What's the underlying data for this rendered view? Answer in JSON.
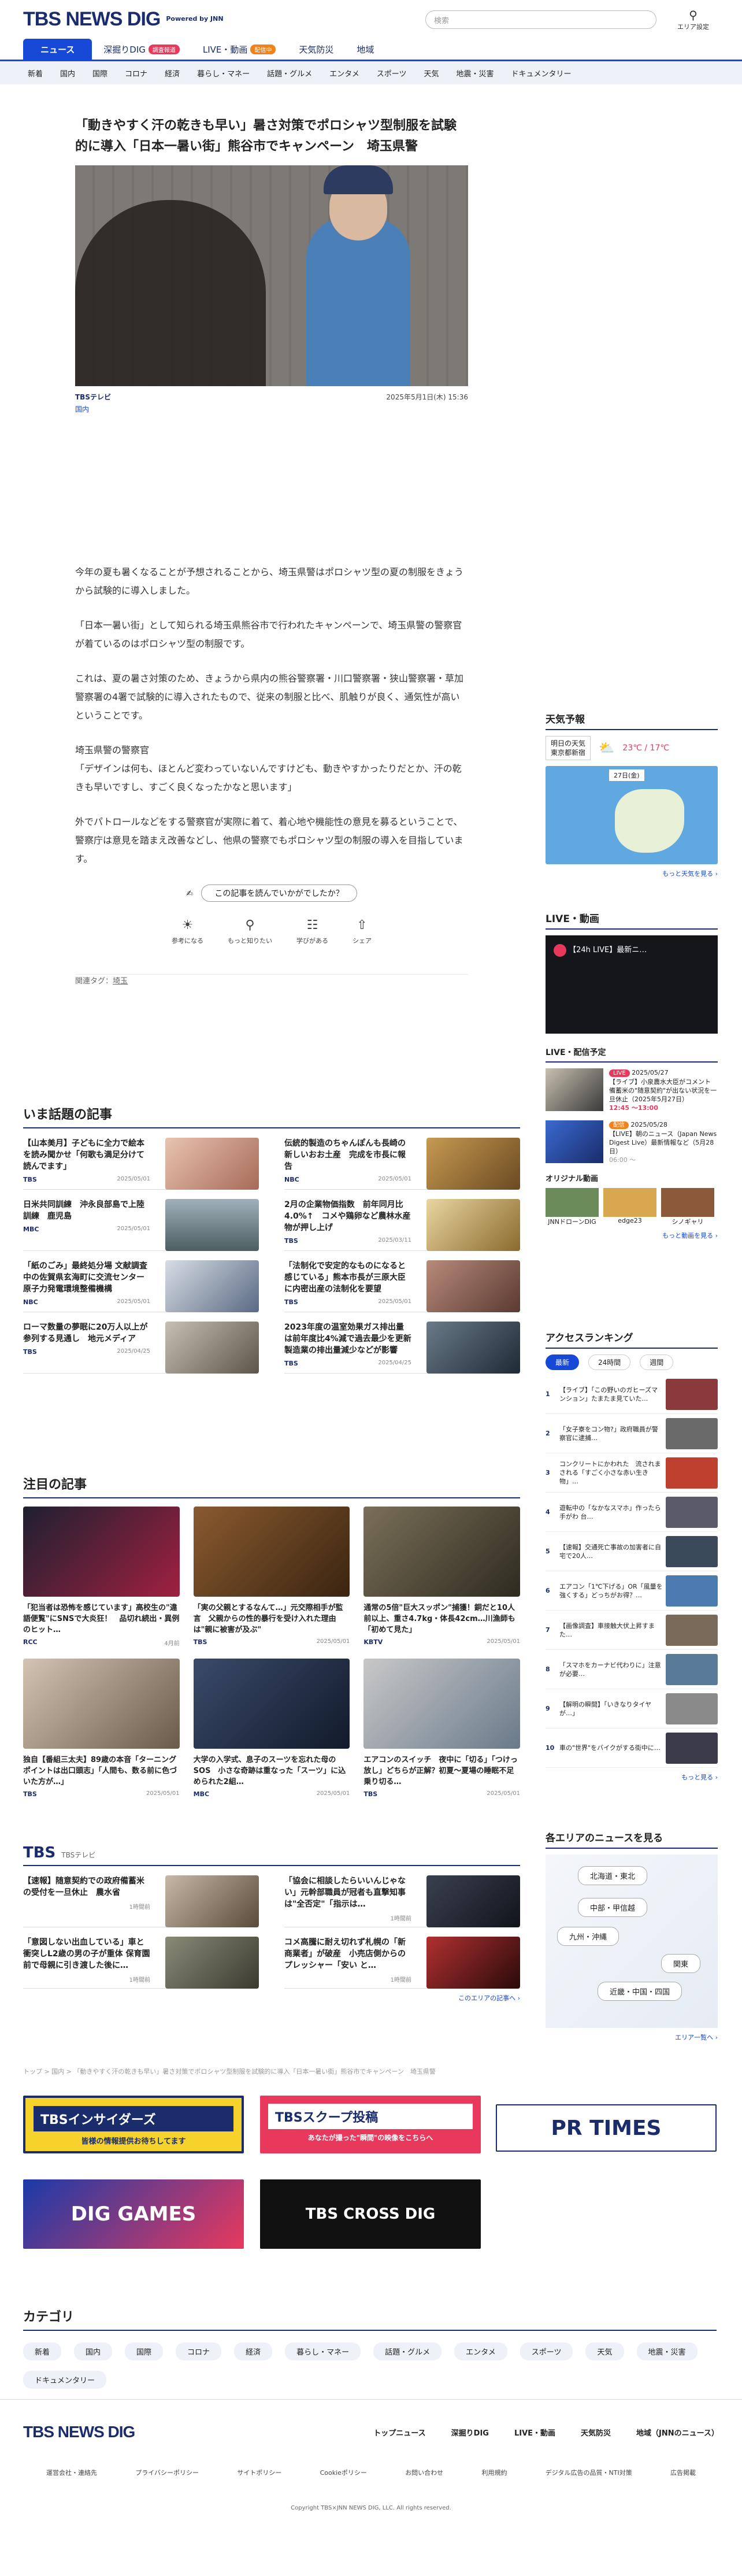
{
  "header": {
    "logo": "TBS NEWS DIG",
    "powered": "Powered by JNN",
    "search_placeholder": "検索",
    "area_label": "エリア設定"
  },
  "tabs": [
    {
      "label": "ニュース"
    },
    {
      "label": "深掘りDIG",
      "badge": "調査報道"
    },
    {
      "label": "LIVE・動画",
      "badge": "配信中"
    },
    {
      "label": "天気防災"
    },
    {
      "label": "地域"
    }
  ],
  "categories": [
    "新着",
    "国内",
    "国際",
    "コロナ",
    "経済",
    "暮らし・マネー",
    "話題・グルメ",
    "エンタメ",
    "スポーツ",
    "天気",
    "地震・災害",
    "ドキュメンタリー"
  ],
  "article": {
    "title": "「動きやすく汗の乾きも早い」暑さ対策でポロシャツ型制服を試験的に導入「日本一暑い街」熊谷市でキャンペーン　埼玉県警",
    "source": "TBSテレビ",
    "date": "2025年5月1日(木) 15:36",
    "category": "国内",
    "paragraphs": [
      "今年の夏も暑くなることが予想されることから、埼玉県警はポロシャツ型の夏の制服をきょうから試験的に導入しました。",
      "「日本一暑い街」として知られる埼玉県熊谷市で行われたキャンペーンで、埼玉県警の警察官が着ているのはポロシャツ型の制服です。",
      "これは、夏の暑さ対策のため、きょうから県内の熊谷警察署・川口警察署・狭山警察署・草加警察署の4署で試験的に導入されたもので、従来の制服と比べ、肌触りが良く、通気性が高いということです。",
      "埼玉県警の警察官\n「デザインは何も、ほとんど変わっていないんですけども、動きやすかったりだとか、汗の乾きも早いですし、すごく良くなったかなと思います」",
      "外でパトロールなどをする警察官が実際に着て、着心地や機能性の意見を募るということで、警察庁は意見を踏まえ改善などし、他県の警察でもポロシャツ型の制服の導入を目指しています。"
    ],
    "rate_question": "この記事を読んでいかがでしたか？",
    "reactions": [
      "参考になる",
      "もっと知りたい",
      "学びがある",
      "シェア"
    ],
    "tags_label": "関連タグ：",
    "tag": "埼玉"
  },
  "trending": {
    "heading": "いま話題の記事",
    "items": [
      {
        "title": "【山本美月】子どもに全力で絵本を読み聞かせ「何歌も満足分けて読んでます」",
        "src": "TBS",
        "date": "2025/05/01"
      },
      {
        "title": "伝統的製造のちゃんぽんも長崎の新しいおお土産　完成を市長に報告",
        "src": "NBC",
        "date": "2025/05/01"
      },
      {
        "title": "日米共同訓練　沖永良部島で上陸訓練　鹿児島",
        "src": "MBC",
        "date": "2025/05/01"
      },
      {
        "title": "2月の企業物価指数　前年同月比4.0%↑　コメや鶏卵など農林水産物が押し上げ",
        "src": "TBS",
        "date": "2025/03/11"
      },
      {
        "title": "「紙のごみ」最終処分場 文献調査中の佐賀県玄海町に交流センター　原子力発電環境整備機構",
        "src": "NBC",
        "date": "2025/05/01"
      },
      {
        "title": "「法制化で安定的なものになると感じている」熊本市長が三原大臣に内密出産の法制化を要望",
        "src": "TBS",
        "date": "2025/05/01"
      },
      {
        "title": "ローマ数量の夢眠に20万人以上が参列する見通し　地元メディア",
        "src": "TBS",
        "date": "2025/04/25"
      },
      {
        "title": "2023年度の温室効果ガス排出量は前年度比4%減で過去最少を更新　製造業の排出量減少などが影響",
        "src": "TBS",
        "date": "2025/04/25"
      }
    ]
  },
  "featured": {
    "heading": "注目の記事",
    "items": [
      {
        "title": "「犯当者は恐怖を感じています」高校生の\"違語便覧\"にSNSで大炎狂！　品切れ続出・異例のヒット…",
        "src": "RCC",
        "date": "4月前"
      },
      {
        "title": "「実の父親とするなんて…」元交際相手が監言　父親からの性的暴行を受け入れた理由は\"親に被害が及ぶ\"",
        "src": "TBS",
        "date": "2025/05/01"
      },
      {
        "title": "通常の5倍\"巨大スッポン\"捕獲！銅だと10人前以上、重さ4.7kg・体長42cm…川漁師も「初めて見た」",
        "src": "KBTV",
        "date": "2025/05/01"
      },
      {
        "title": "独自【番組三太夫】89歳の本音「ターニングポイントは出口頭志」「人間も、数る前に色づいた方が…」",
        "src": "TBS",
        "date": "2025/05/01"
      },
      {
        "title": "大学の入学式、息子のスーツを忘れた母のSOS　小さな奇跡は重なった「スーツ」に込められた2組…",
        "src": "MBC",
        "date": "2025/05/01"
      },
      {
        "title": "エアコンのスイッチ　夜中に「切る」「つけっ放し」どちらが正解？初夏～夏場の睡眠不足　乗り切る…",
        "src": "TBS",
        "date": "2025/05/01"
      }
    ]
  },
  "tbs_section": {
    "logo": "TBS",
    "sub": "TBSテレビ",
    "items": [
      {
        "title": "【速報】随意契約での政府備蓄米の受付を一旦休止　農水省",
        "date": "1時間前"
      },
      {
        "title": "「協会に相談したらいいんじゃない」元幹部職員が冠者も直撃知事は\"全否定\"「指示は…",
        "date": "1時間前"
      },
      {
        "title": "「意図しない出血している」車と衝突しL2歳の男の子が重体 保育園前で母親に引き渡した後に…",
        "date": "1時間前"
      },
      {
        "title": "コメ高騰に耐え切れず札幌の「新商業者」が破産　小売店側からのプレッシャー「安い と…",
        "date": "1時間前"
      }
    ],
    "more": "このエリアの記事へ ›"
  },
  "breadcrumb": "トップ > 国内 > 「動きやすく汗の乾きも早い」暑さ対策でポロシャツ型制服を試験的に導入「日本一暑い街」熊谷市でキャンペーン　埼玉県警",
  "banners": [
    "TBSインサイダーズ",
    "TBSスクープ投稿",
    "PR TIMES",
    "DIG GAMES",
    "TBS CROSS DIG"
  ],
  "banner_sub": [
    "皆様の情報提供お待ちしてます",
    "あなたが撮った\"瞬間\"の映像をこちらへ"
  ],
  "weather": {
    "heading": "天気予報",
    "date": "明日の天気",
    "place": "東京都新宿",
    "temp": "23℃ / 17℃",
    "map_date": "27日(金)",
    "more": "もっと天気を見る ›"
  },
  "live": {
    "heading": "LIVE・動画",
    "title": "【24h LIVE】最新ニ…",
    "schedule_heading": "LIVE・配信予定",
    "schedule": [
      {
        "tag": "LIVE",
        "date": "2025/05/27",
        "title": "【ライブ】小泉農水大臣がコメント　備蓄米の\"随意契約\"が出ない状況を一旦休止（2025年5月27日）",
        "time": "12:45 〜13:00"
      },
      {
        "tag": "配信",
        "date": "2025/05/28",
        "title": "【LIVE】朝のニュース（Japan News Digest Live）最新情報など（5月28日）",
        "time": "06:00 〜"
      }
    ],
    "orig_heading": "オリジナル動画",
    "orig": [
      "JNNドローンDIG",
      "edge23",
      "シノギャリ"
    ],
    "more": "もっと動画を見る ›"
  },
  "ranking": {
    "heading": "アクセスランキング",
    "tabs": [
      "最新",
      "24時間",
      "週間"
    ],
    "items": [
      "【ライブ】「この野いのガヒーズマンション」たまたま見ていた…",
      "「女子寮をコン物?」政府職員が警察官に逮捕…",
      "コンクリートにかわれた　流されまされる「すごく小さな赤い生き物」…",
      "遊転中の「なかなスマホ」作ったら手がわ 台…",
      "【速報】交通死亡事故の加害者に自宅で20人…",
      "エアコン「1℃下げる」OR「風量を強くする」どっちがお得？…",
      "【画像調査】車接触大伏上昇すまた…",
      "「スマホをカーナビ代わりに」注意が必要…",
      "【解明の瞬間】「いきなりタイヤが…」",
      "車の\"世界\"をバイクがする街中に…"
    ],
    "more": "もっと見る ›"
  },
  "area_news": {
    "heading": "各エリアのニュースを見る",
    "regions": [
      "北海道・東北",
      "中部・甲信越",
      "九州・沖縄",
      "関東",
      "近畿・中国・四国"
    ],
    "more": "エリア一覧へ ›"
  },
  "category_section": {
    "heading": "カテゴリ",
    "chips": [
      "新着",
      "国内",
      "国際",
      "コロナ",
      "経済",
      "暮らし・マネー",
      "話題・グルメ",
      "エンタメ",
      "スポーツ",
      "天気",
      "地震・災害",
      "ドキュメンタリー"
    ]
  },
  "footer": {
    "logo": "TBS NEWS DIG",
    "nav": [
      "トップニュース",
      "深掘りDIG",
      "LIVE・動画",
      "天気防災",
      "地域（JNNのニュース）"
    ],
    "links": [
      "運営会社・連絡先",
      "プライバシーポリシー",
      "サイトポリシー",
      "Cookieポリシー",
      "お問い合わせ",
      "利用規約",
      "デジタル広告の品質・NTI対策",
      "広告掲載"
    ],
    "copyright": "Copyright TBS×JNN NEWS DIG, LLC. All rights reserved."
  },
  "colors": {
    "brand": "#1a2c6b",
    "accent": "#1848d6",
    "badge_red": "#e8395d",
    "badge_orange": "#f0821e"
  }
}
